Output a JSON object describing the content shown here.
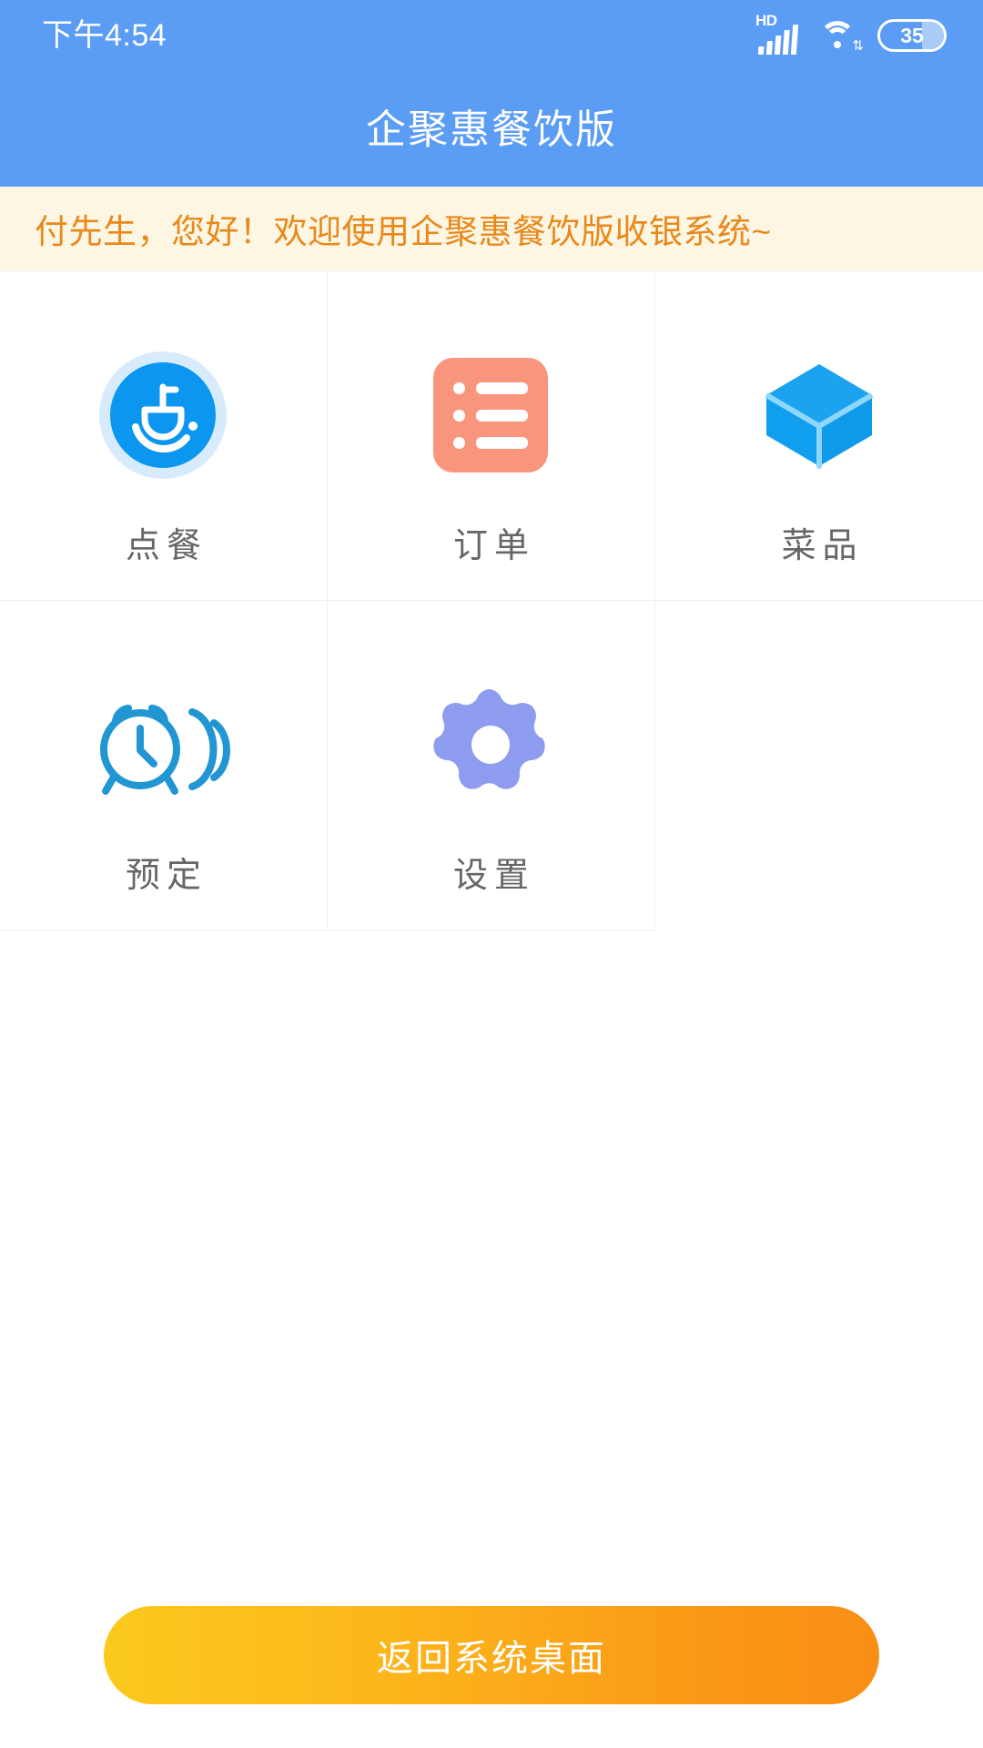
{
  "status_bar": {
    "time": "下午4:54",
    "network_label": "HD",
    "battery_level": "35",
    "signal_icon": "signal-bars-icon",
    "wifi_icon": "wifi-icon",
    "battery_icon": "battery-icon"
  },
  "header": {
    "title": "企聚惠餐饮版",
    "background_color": "#5b9cf5"
  },
  "welcome": {
    "text": "付先生，您好！欢迎使用企聚惠餐饮版收银系统~",
    "text_color": "#e8891c",
    "background_color": "#fdf6e3"
  },
  "grid": {
    "items": [
      {
        "label": "点餐",
        "icon": "meal-bowl-icon",
        "color": "#0b96f0"
      },
      {
        "label": "订单",
        "icon": "order-list-icon",
        "color": "#f8957c"
      },
      {
        "label": "菜品",
        "icon": "dish-cube-icon",
        "color": "#129ceb"
      },
      {
        "label": "预定",
        "icon": "reservation-alarm-phone-icon",
        "color": "#2196d3"
      },
      {
        "label": "设置",
        "icon": "settings-gear-icon",
        "color": "#8e9cf0"
      }
    ]
  },
  "footer": {
    "home_button_label": "返回系统桌面",
    "gradient_start": "#fbc91d",
    "gradient_end": "#f98e15"
  }
}
